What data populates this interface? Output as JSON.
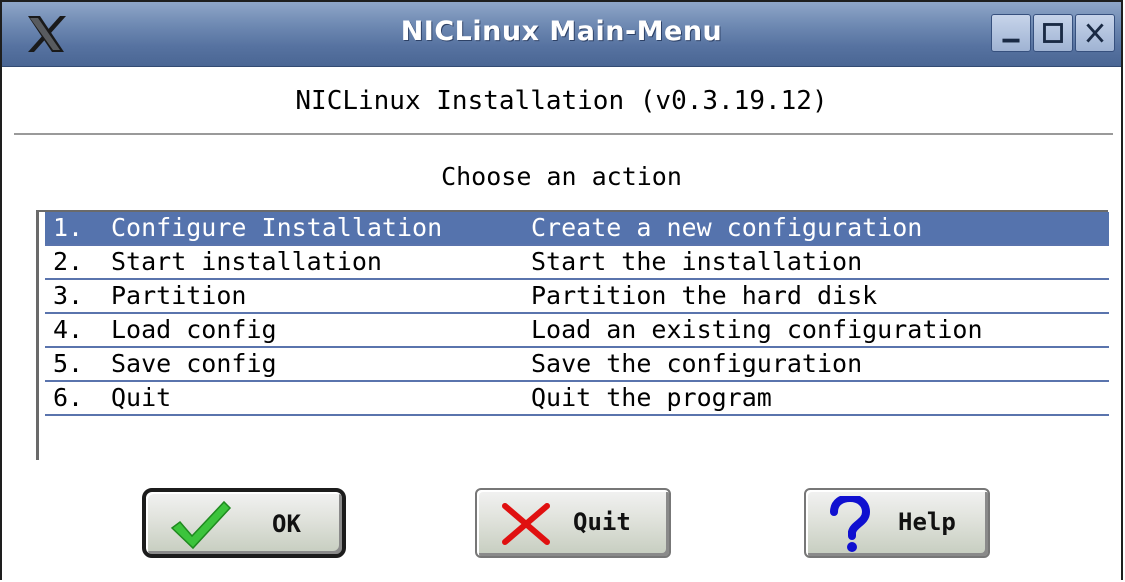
{
  "window": {
    "title": "NICLinux Main-Menu",
    "controls": [
      "minimize",
      "maximize",
      "close"
    ]
  },
  "header": {
    "installation_title": "NICLinux Installation (v0.3.19.12)",
    "prompt": "Choose an action"
  },
  "menu": {
    "selected_index": 0,
    "items": [
      {
        "number": "1.",
        "name": "Configure Installation",
        "description": "Create a new configuration"
      },
      {
        "number": "2.",
        "name": "Start installation",
        "description": "Start the installation"
      },
      {
        "number": "3.",
        "name": "Partition",
        "description": "Partition the hard disk"
      },
      {
        "number": "4.",
        "name": "Load config",
        "description": "Load an existing configuration"
      },
      {
        "number": "5.",
        "name": "Save config",
        "description": "Save the configuration"
      },
      {
        "number": "6.",
        "name": "Quit",
        "description": "Quit the program"
      }
    ]
  },
  "buttons": {
    "ok_label": "OK",
    "quit_label": "Quit",
    "help_label": "Help"
  },
  "icons": {
    "app": "x-logo-icon",
    "ok": "checkmark-icon",
    "quit": "cross-icon",
    "help": "question-mark-icon"
  },
  "colors": {
    "titlebar": "#5672a0",
    "selection": "#5573ad",
    "row_divider": "#5a74ad",
    "check": "#3cc43c",
    "cross": "#e01010",
    "help": "#1010d0"
  }
}
